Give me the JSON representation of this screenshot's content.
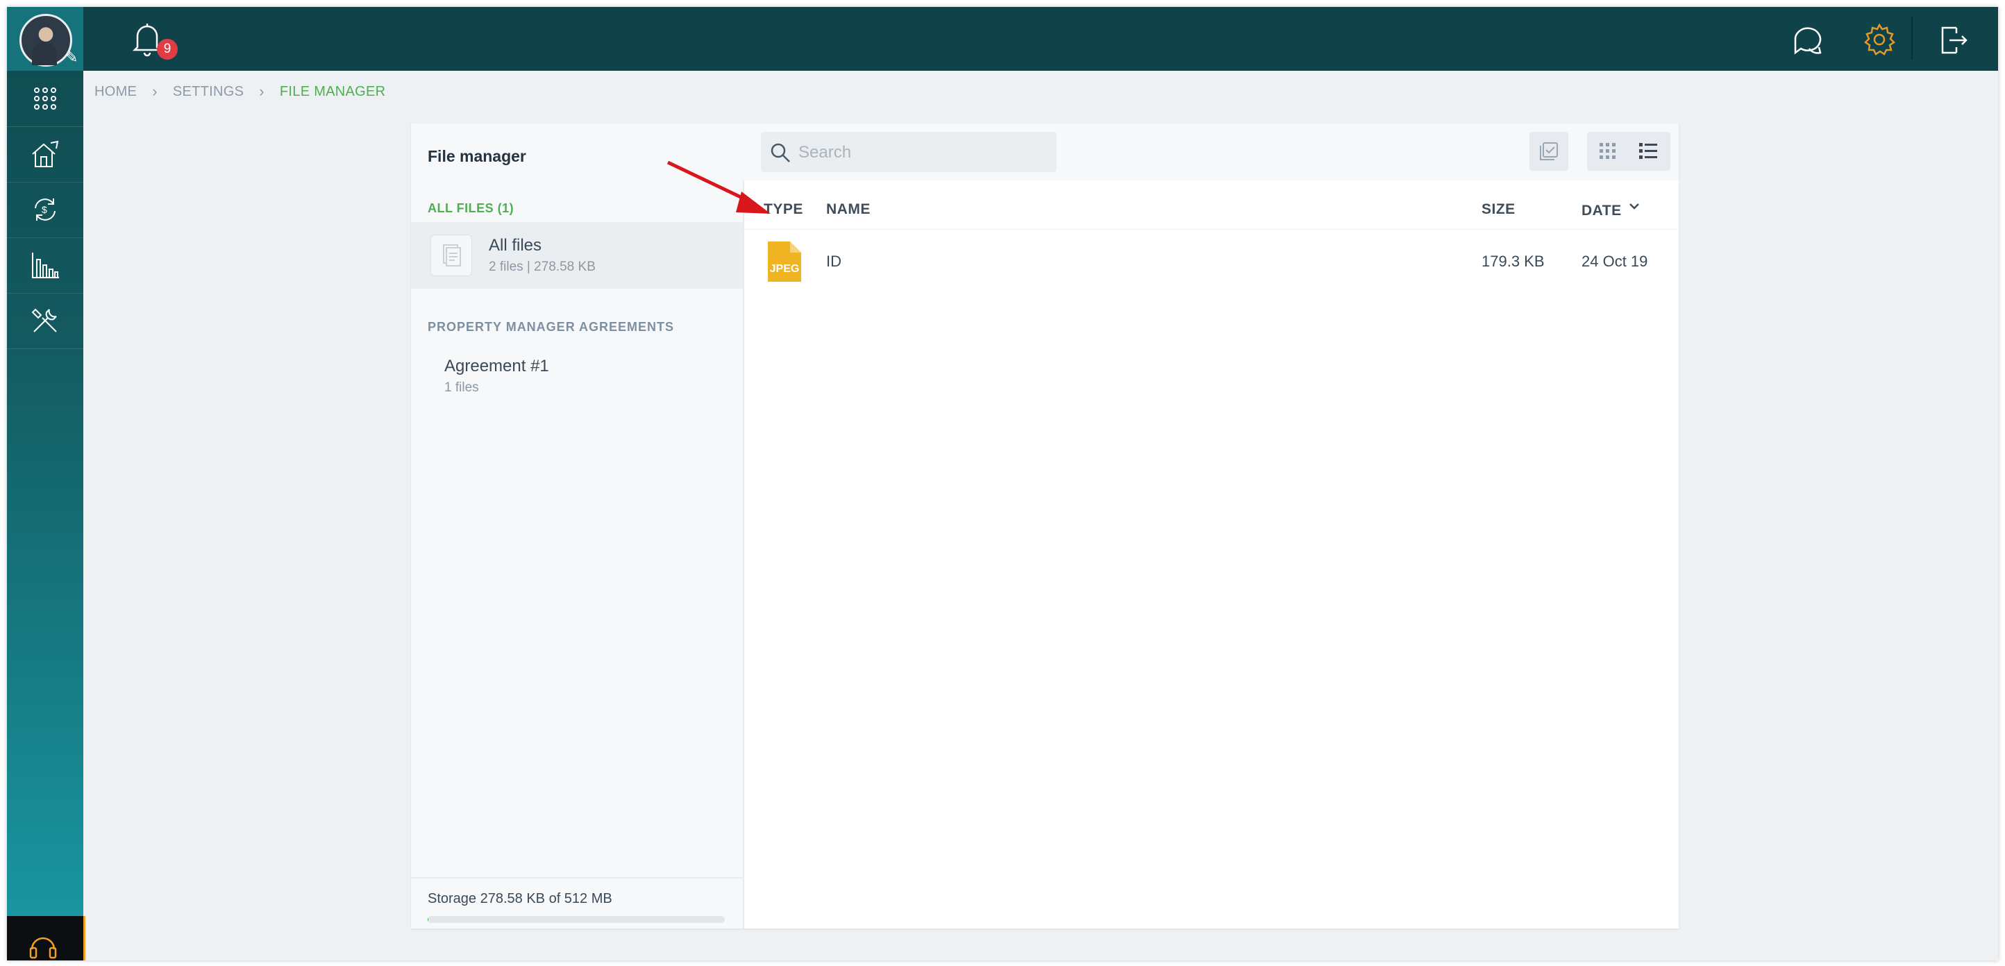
{
  "topbar": {
    "notification_count": "9"
  },
  "breadcrumb": {
    "items": [
      "HOME",
      "SETTINGS",
      "FILE MANAGER"
    ],
    "separator": "›"
  },
  "file_manager": {
    "title": "File manager",
    "all_files_section": "ALL FILES (1)",
    "all_files_item": {
      "name": "All files",
      "meta": "2 files | 278.58 KB"
    },
    "folders_section": "PROPERTY MANAGER AGREEMENTS",
    "folders": [
      {
        "name": "Agreement #1",
        "meta": "1 files"
      }
    ],
    "storage": {
      "label": "Storage 278.58 KB of 512 MB",
      "used_fraction": 0.0005
    }
  },
  "file_list": {
    "search_placeholder": "Search",
    "columns": {
      "type": "TYPE",
      "name": "NAME",
      "size": "SIZE",
      "date": "DATE"
    },
    "rows": [
      {
        "type": "JPEG",
        "name": "ID",
        "size": "179.3 KB",
        "date": "24 Oct 19"
      }
    ]
  },
  "colors": {
    "accent_green": "#4caf50",
    "topbar_bg": "#0f4249",
    "badge_red": "#e03c45",
    "gear_orange": "#e39a2d",
    "jpeg_yellow": "#f0b322",
    "annotation_red": "#d9161c"
  },
  "icons": [
    "bell-icon",
    "apps-grid-icon",
    "house-icon",
    "exchange-icon",
    "chart-icon",
    "tools-icon",
    "headset-icon",
    "chat-icon",
    "gear-icon",
    "logout-icon",
    "search-icon",
    "select-icon",
    "grid-view-icon",
    "list-view-icon",
    "chevron-down-icon",
    "jpeg-file-icon"
  ]
}
